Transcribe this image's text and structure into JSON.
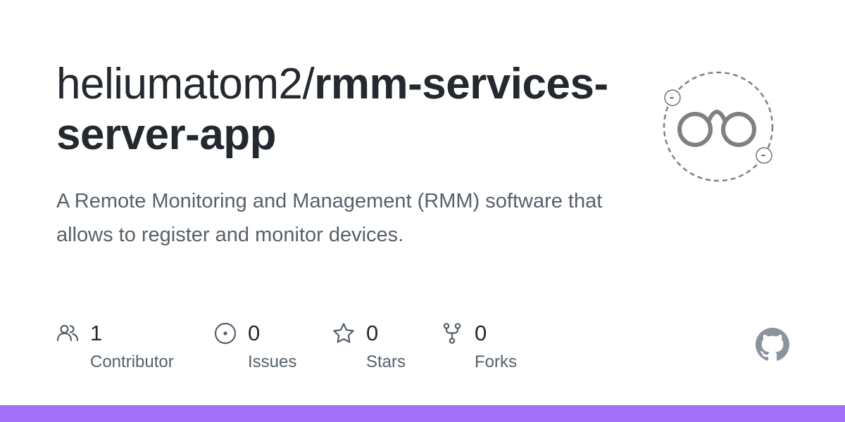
{
  "repository": {
    "owner": "heliumatom2/",
    "name": "rmm-services-server-app",
    "description": "A Remote Monitoring and Management (RMM) software that allows to register and monitor devices."
  },
  "stats": [
    {
      "icon": "people-icon",
      "value": "1",
      "label": "Contributor"
    },
    {
      "icon": "issue-opened-icon",
      "value": "0",
      "label": "Issues"
    },
    {
      "icon": "star-icon",
      "value": "0",
      "label": "Stars"
    },
    {
      "icon": "fork-icon",
      "value": "0",
      "label": "Forks"
    }
  ],
  "colors": {
    "title": "#24292f",
    "muted": "#57606a",
    "icon": "#57606a",
    "github_logo": "#8b949e",
    "bottom_bar": "#a371f7",
    "avatar_stroke": "#808080"
  }
}
